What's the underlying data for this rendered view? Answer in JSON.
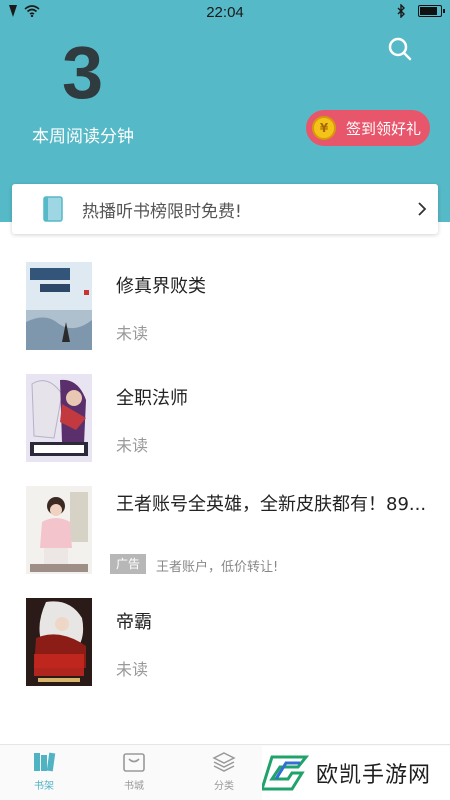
{
  "status_bar": {
    "time": "22:04"
  },
  "header": {
    "reading_minutes": "3",
    "reading_label": "本周阅读分钟",
    "checkin_label": "签到领好礼",
    "coin_symbol": "¥",
    "accent_color": "#56b9c7"
  },
  "promo": {
    "text": "热播听书榜限时免费!"
  },
  "books": [
    {
      "title": "修真界败类",
      "status": "未读"
    },
    {
      "title": "全职法师",
      "status": "未读"
    },
    {
      "title": "王者账号全英雄，全新皮肤都有！89...",
      "ad_tag": "广告",
      "ad_desc": "王者账户，低价转让!"
    },
    {
      "title": "帝霸",
      "status": "未读"
    }
  ],
  "tabs": [
    {
      "label": "书架",
      "icon": "bookshelf-icon",
      "active": true
    },
    {
      "label": "书城",
      "icon": "store-icon",
      "active": false
    },
    {
      "label": "分类",
      "icon": "layers-icon",
      "active": false
    }
  ],
  "watermark": {
    "text": "欧凯手游网"
  }
}
